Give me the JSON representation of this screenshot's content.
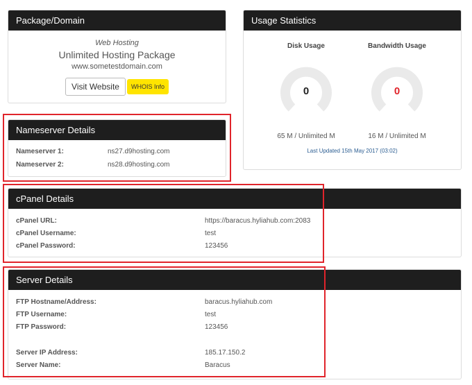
{
  "package": {
    "title": "Package/Domain",
    "type": "Web Hosting",
    "name": "Unlimited Hosting Package",
    "domain": "www.sometestdomain.com",
    "visit_label": "Visit Website",
    "whois_label": "WHOIS Info"
  },
  "usage": {
    "title": "Usage Statistics",
    "disk": {
      "title": "Disk Usage",
      "value": "0",
      "amount": "65 M / Unlimited M",
      "color": "#222222"
    },
    "bandwidth": {
      "title": "Bandwidth Usage",
      "value": "0",
      "amount": "16 M / Unlimited M",
      "color": "#e0242b"
    },
    "last_updated": "Last Updated 15th May 2017 (03:02)",
    "gauge_track_color": "#eaeaea"
  },
  "nameservers": {
    "title": "Nameserver Details",
    "rows": [
      {
        "label": "Nameserver 1:",
        "value": "ns27.d9hosting.com"
      },
      {
        "label": "Nameserver 2:",
        "value": "ns28.d9hosting.com"
      }
    ]
  },
  "cpanel": {
    "title": "cPanel Details",
    "rows": [
      {
        "label": "cPanel URL:",
        "value": "https://baracus.hyliahub.com:2083"
      },
      {
        "label": "cPanel Username:",
        "value": "test"
      },
      {
        "label": "cPanel Password:",
        "value": "123456"
      }
    ]
  },
  "server": {
    "title": "Server Details",
    "rows": [
      {
        "label": "FTP Hostname/Address:",
        "value": "baracus.hyliahub.com"
      },
      {
        "label": "FTP Username:",
        "value": "test"
      },
      {
        "label": "FTP Password:",
        "value": "123456"
      },
      {
        "label": "Server IP Address:",
        "value": "185.17.150.2"
      },
      {
        "label": "Server Name:",
        "value": "Baracus"
      }
    ]
  },
  "highlight_color": "#e0242b"
}
